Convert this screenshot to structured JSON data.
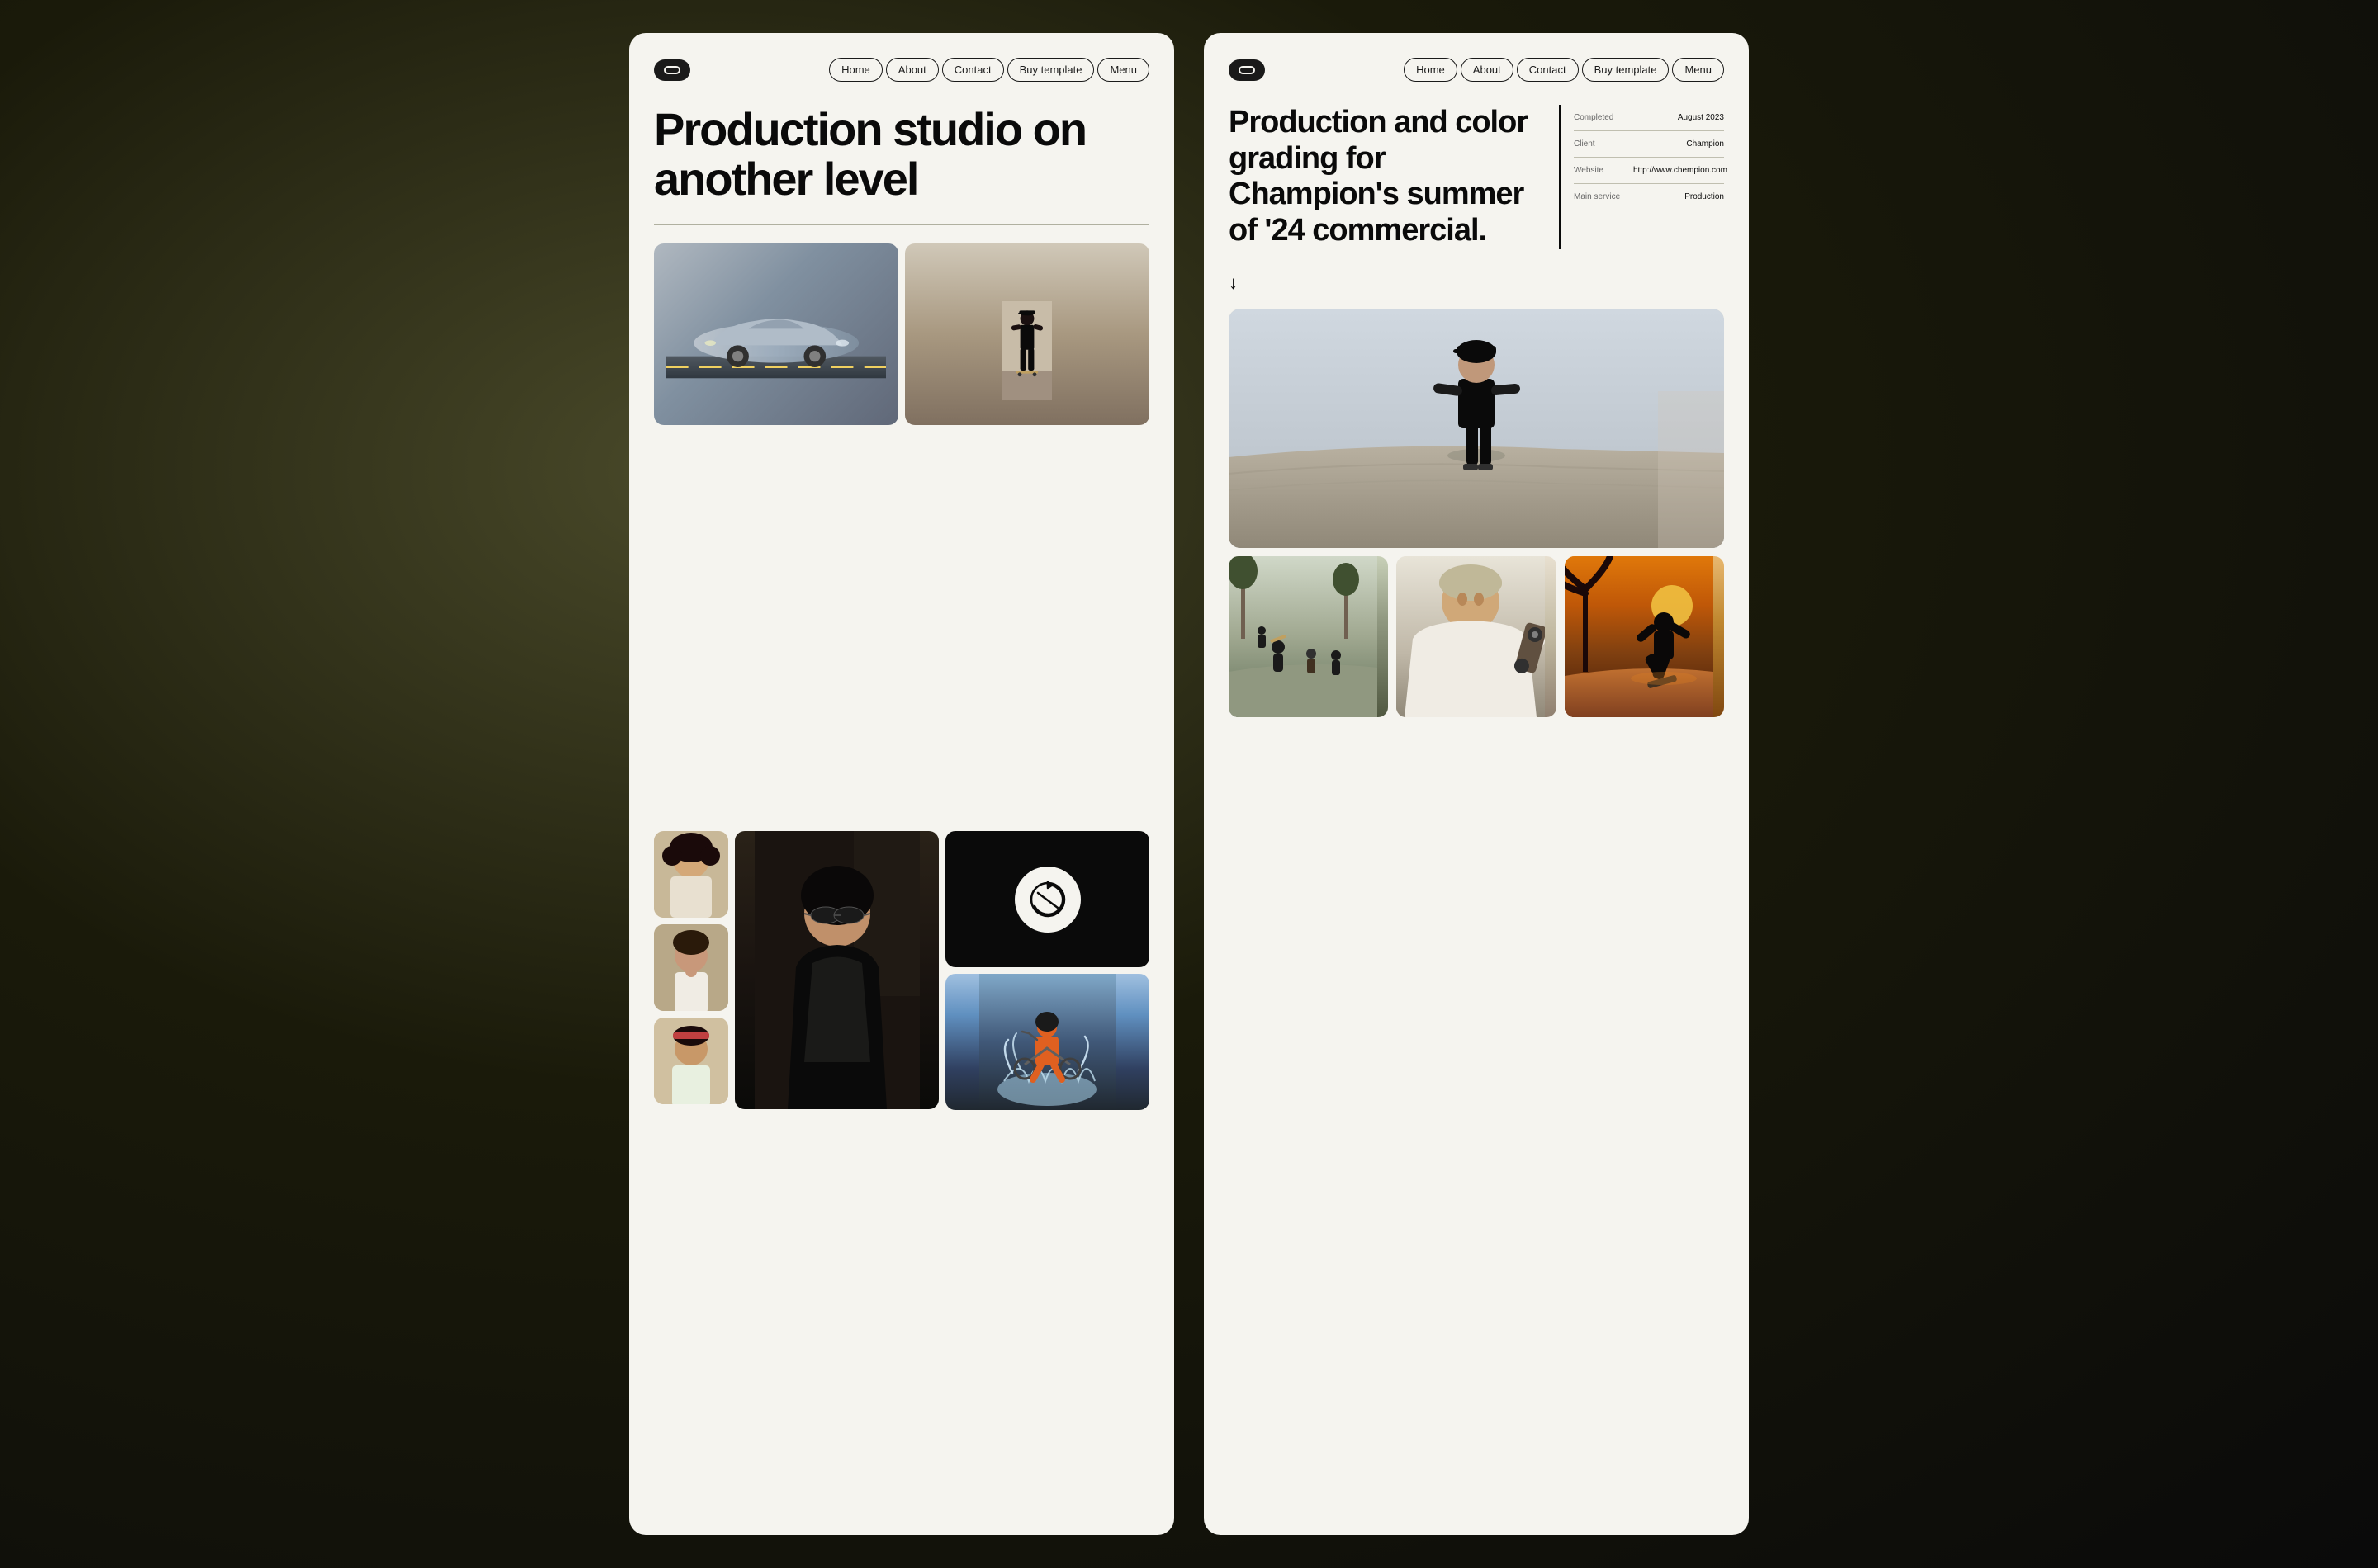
{
  "panels": {
    "panel1": {
      "logo": "◯",
      "nav": {
        "links": [
          "Home",
          "About",
          "Contact",
          "Buy template",
          "Menu"
        ]
      },
      "heading": "Production studio on another level",
      "photos": {
        "car_alt": "Silver sports car on road",
        "skater_alt": "Person skateboarding",
        "portrait1_alt": "Woman with curly hair",
        "portrait2_alt": "Man touching chin",
        "portrait3_alt": "Woman with headband",
        "woman_dark_alt": "Woman with sunglasses dark background",
        "logo_icon": "↺",
        "biker_alt": "Mountain biker in water splash"
      }
    },
    "panel2": {
      "logo": "◯",
      "nav": {
        "links": [
          "Home",
          "About",
          "Contact",
          "Buy template",
          "Menu"
        ]
      },
      "title": "Production and color grading for Champion's summer of '24 commercial.",
      "meta": [
        {
          "label": "Completed",
          "value": "August 2023"
        },
        {
          "label": "Client",
          "value": "Champion"
        },
        {
          "label": "Website",
          "value": "http://www.chempion.com"
        },
        {
          "label": "Main service",
          "value": "Production"
        }
      ],
      "arrow": "↓",
      "photos": {
        "main_skater_alt": "Skateboarder walking on ramp",
        "bottom1_alt": "Skateboarders at park",
        "bottom2_alt": "Skateboarder jumping close up",
        "bottom3_alt": "Skateboarder at sunset"
      }
    }
  }
}
